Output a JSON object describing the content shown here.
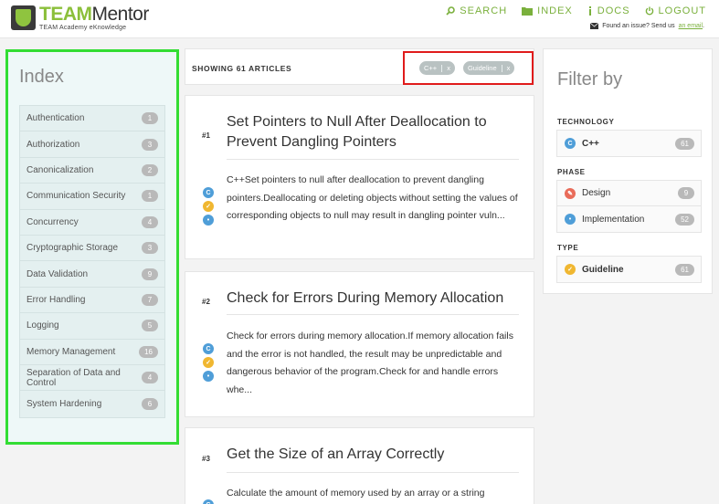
{
  "header": {
    "logo_brand": "TEAM",
    "logo_brand_rest": "Mentor",
    "logo_subtitle": "TEAM Academy eKnowledge",
    "nav": [
      {
        "label": "SEARCH",
        "icon": "search-icon"
      },
      {
        "label": "INDEX",
        "icon": "folder-icon"
      },
      {
        "label": "DOCS",
        "icon": "info-icon"
      },
      {
        "label": "LOGOUT",
        "icon": "power-icon"
      }
    ],
    "issue_text": "Found an issue? Send us",
    "issue_link": "an email",
    "issue_end": "."
  },
  "index": {
    "title": "Index",
    "items": [
      {
        "label": "Authentication",
        "count": "1"
      },
      {
        "label": "Authorization",
        "count": "3"
      },
      {
        "label": "Canonicalization",
        "count": "2"
      },
      {
        "label": "Communication Security",
        "count": "1"
      },
      {
        "label": "Concurrency",
        "count": "4"
      },
      {
        "label": "Cryptographic Storage",
        "count": "3"
      },
      {
        "label": "Data Validation",
        "count": "9"
      },
      {
        "label": "Error Handling",
        "count": "7"
      },
      {
        "label": "Logging",
        "count": "5"
      },
      {
        "label": "Memory Management",
        "count": "16"
      },
      {
        "label": "Separation of Data and Control",
        "count": "4"
      },
      {
        "label": "System Hardening",
        "count": "6"
      }
    ]
  },
  "results": {
    "count_label": "SHOWING 61 ARTICLES",
    "active_filters": [
      {
        "label": "C++",
        "remove": "x"
      },
      {
        "label": "Guideline",
        "remove": "x"
      }
    ]
  },
  "articles": [
    {
      "num": "#1",
      "title": "Set Pointers to Null After Deallocation to Prevent Dangling Pointers",
      "desc": "C++Set pointers to null after deallocation to prevent dangling pointers.Deallocating or deleting objects without setting the values of corresponding objects to null may result in dangling pointer vuln..."
    },
    {
      "num": "#2",
      "title": "Check for Errors During Memory Allocation",
      "desc": "Check for errors during memory allocation.If memory allocation fails and the error is not handled, the result may be unpredictable and dangerous behavior of the program.Check for and handle errors whe..."
    },
    {
      "num": "#3",
      "title": "Get the Size of an Array Correctly",
      "desc": "Calculate the amount of memory used by an array or a string"
    }
  ],
  "filter": {
    "title": "Filter by",
    "groups": [
      {
        "title": "TECHNOLOGY",
        "items": [
          {
            "label": "C++",
            "count": "61",
            "icon": "cpp-icon",
            "color": "#4f9ed8"
          }
        ]
      },
      {
        "title": "PHASE",
        "items": [
          {
            "label": "Design",
            "count": "9",
            "icon": "design-icon",
            "color": "#e96c5a"
          },
          {
            "label": "Implementation",
            "count": "52",
            "icon": "implementation-icon",
            "color": "#4f9ed8"
          }
        ]
      },
      {
        "title": "TYPE",
        "items": [
          {
            "label": "Guideline",
            "count": "61",
            "icon": "guideline-icon",
            "color": "#f0b731"
          }
        ]
      }
    ]
  },
  "colors": {
    "accent_green": "#7ab03c",
    "index_highlight_border": "#33dd33",
    "filter_highlight_border": "#e01b1b"
  }
}
